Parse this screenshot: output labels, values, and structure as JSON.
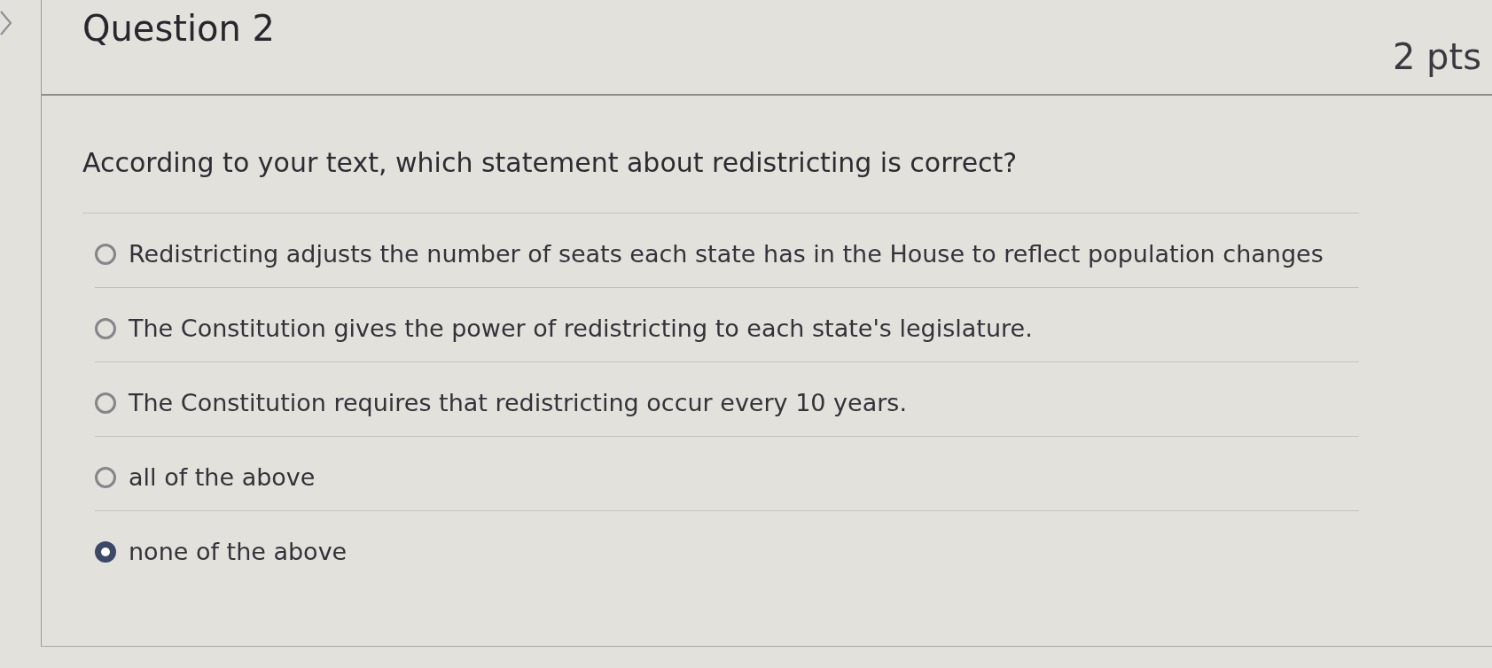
{
  "question": {
    "title": "Question 2",
    "points": "2 pts",
    "text": "According to your text, which statement about redistricting is correct?",
    "answers": [
      {
        "label": "Redistricting adjusts the number of seats each state has in the House to reflect population changes",
        "selected": false
      },
      {
        "label": "The Constitution gives the power of redistricting to each state's legislature.",
        "selected": false
      },
      {
        "label": "The Constitution requires that redistricting occur every 10 years.",
        "selected": false
      },
      {
        "label": "all of the above",
        "selected": false
      },
      {
        "label": "none of the above",
        "selected": true
      }
    ]
  }
}
